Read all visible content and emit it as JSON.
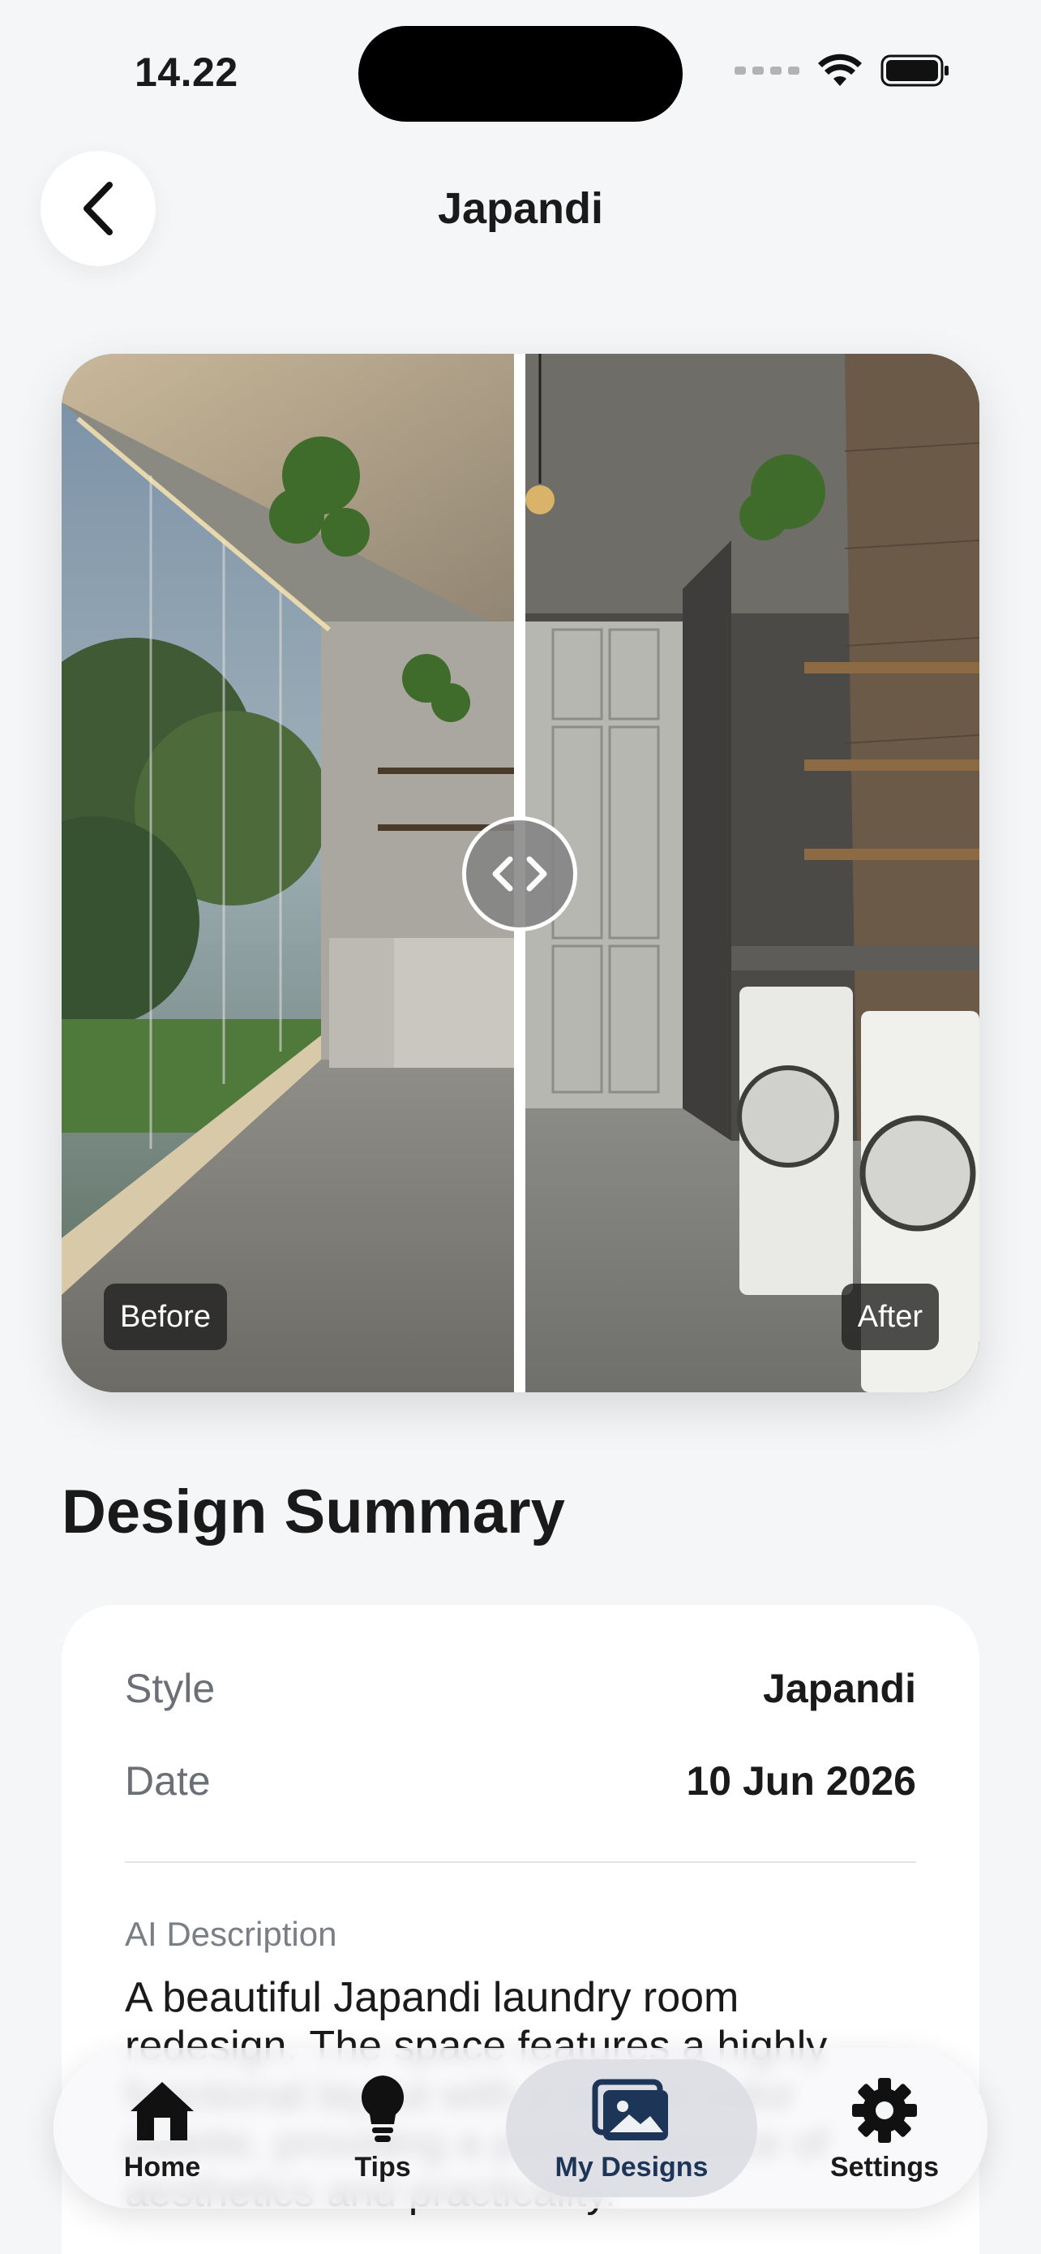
{
  "status_bar": {
    "time": "14.22"
  },
  "header": {
    "title": "Japandi",
    "back_icon": "chevron-left-icon"
  },
  "compare": {
    "before_label": "Before",
    "after_label": "After",
    "handle_icon": "code-arrows-icon"
  },
  "summary": {
    "title": "Design Summary",
    "rows": [
      {
        "label": "Style",
        "value": "Japandi"
      },
      {
        "label": "Date",
        "value": "10 Jun 2026"
      }
    ],
    "ai_label": "AI Description",
    "ai_text": "A beautiful Japandi laundry room redesign. The space features a highly functional layout with a serene color palette, providing a perfect balance of aesthetics and practicality."
  },
  "tabbar": {
    "items": [
      {
        "label": "Home",
        "icon": "house-icon"
      },
      {
        "label": "Tips",
        "icon": "lightbulb-icon"
      },
      {
        "label": "My Designs",
        "icon": "photos-icon",
        "active": true
      },
      {
        "label": "Settings",
        "icon": "gear-icon"
      }
    ]
  },
  "colors": {
    "accent": "#1d3557",
    "background": "#f5f6f8",
    "card": "#ffffff"
  }
}
